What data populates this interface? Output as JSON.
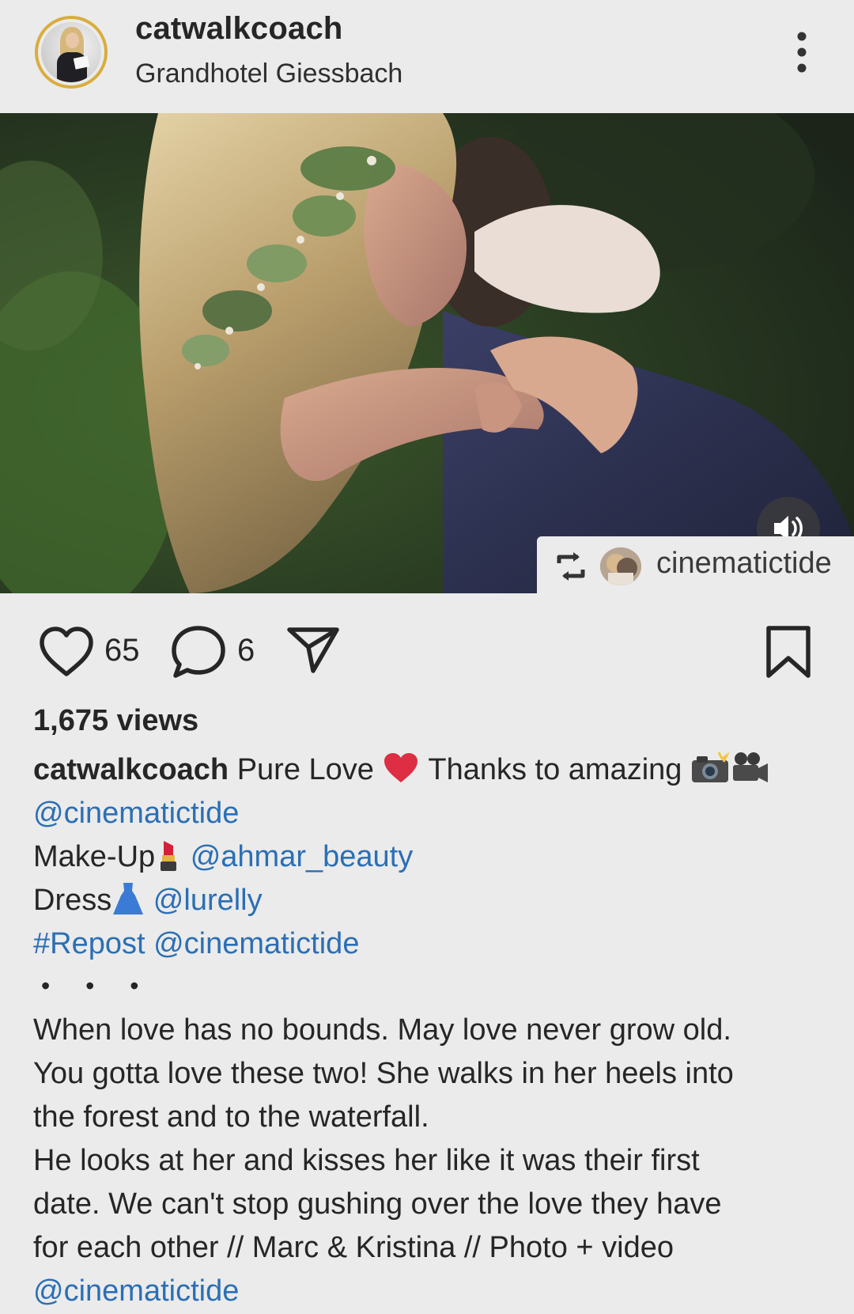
{
  "post": {
    "username": "catwalkcoach",
    "location": "Grandhotel Giessbach",
    "more_icon": "more-vertical-icon"
  },
  "media": {
    "type": "video",
    "sound_icon": "volume-icon",
    "repost": {
      "icon": "repost-icon",
      "username": "cinematictide"
    }
  },
  "actions": {
    "like_count": "65",
    "comment_count": "6",
    "icons": [
      "heart-icon",
      "comment-icon",
      "send-icon",
      "bookmark-icon"
    ]
  },
  "stats": {
    "views": "1,675 views"
  },
  "caption": {
    "owner": "catwalkcoach",
    "line1_text": " Pure Love ",
    "line1_text2": " Thanks to amazing ",
    "line2_mention": "@cinematictide",
    "line3_label": "Make-Up",
    "line3_mention": "@ahmar_beauty",
    "line4_label": "Dress",
    "line4_mention": "@lurelly",
    "line5_hashtag": "#Repost",
    "line5_mention": "@cinematictide",
    "dots": "• • •",
    "body_lines": [
      "When love has no bounds. May love never grow old.",
      "You gotta love these two! She walks in her heels into",
      "the forest and to the waterfall.",
      "He looks at her and kisses her like it was their first",
      "date. We can't stop gushing over the love they have",
      "for each other // Marc & Kristina // Photo + video"
    ],
    "final_mention": "@cinematictide"
  },
  "colors": {
    "background": "#ebebeb",
    "link": "#2b6fb5",
    "avatar_ring": "#d9ad3c",
    "text": "#262626"
  }
}
